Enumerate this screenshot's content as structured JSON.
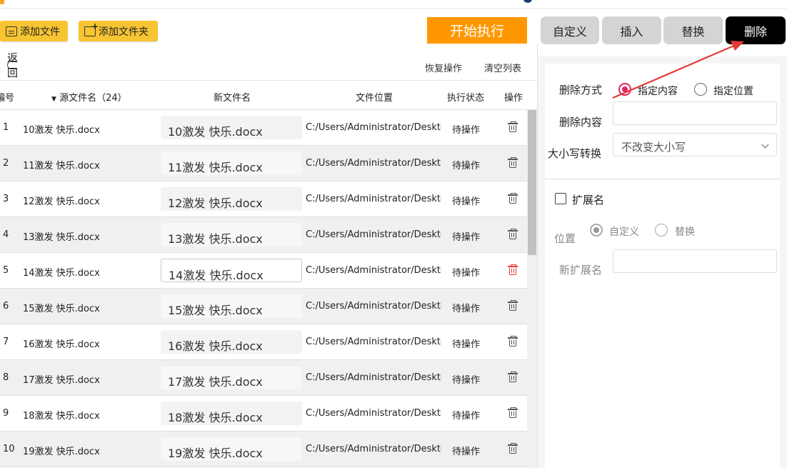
{
  "toolbar": {
    "add_file": "添加文件",
    "add_folder": "添加文件夹",
    "start": "开始执行"
  },
  "tabs": [
    {
      "label": "自定义"
    },
    {
      "label": "插入"
    },
    {
      "label": "替换"
    },
    {
      "label": "删除"
    }
  ],
  "list_actions": {
    "back": "返回",
    "restore": "恢复操作",
    "clear": "清空列表"
  },
  "columns": {
    "num": "编号",
    "source": "源文件名（24）",
    "new_name": "新文件名",
    "location": "文件位置",
    "status": "执行状态",
    "action": "操作"
  },
  "rows": [
    {
      "num": "1",
      "source": "10激发 快乐.docx",
      "new_name": "10激发 快乐.docx",
      "location": "C:/Users/Administrator/Desktop/",
      "status": "待操作"
    },
    {
      "num": "2",
      "source": "11激发 快乐.docx",
      "new_name": "11激发 快乐.docx",
      "location": "C:/Users/Administrator/Desktop/",
      "status": "待操作"
    },
    {
      "num": "3",
      "source": "12激发 快乐.docx",
      "new_name": "12激发 快乐.docx",
      "location": "C:/Users/Administrator/Desktop/",
      "status": "待操作"
    },
    {
      "num": "4",
      "source": "13激发 快乐.docx",
      "new_name": "13激发 快乐.docx",
      "location": "C:/Users/Administrator/Desktop/",
      "status": "待操作"
    },
    {
      "num": "5",
      "source": "14激发 快乐.docx",
      "new_name": "14激发 快乐.docx",
      "location": "C:/Users/Administrator/Desktop/",
      "status": "待操作"
    },
    {
      "num": "6",
      "source": "15激发 快乐.docx",
      "new_name": "15激发 快乐.docx",
      "location": "C:/Users/Administrator/Desktop/",
      "status": "待操作"
    },
    {
      "num": "7",
      "source": "16激发 快乐.docx",
      "new_name": "16激发 快乐.docx",
      "location": "C:/Users/Administrator/Desktop/",
      "status": "待操作"
    },
    {
      "num": "8",
      "source": "17激发 快乐.docx",
      "new_name": "17激发 快乐.docx",
      "location": "C:/Users/Administrator/Desktop/",
      "status": "待操作"
    },
    {
      "num": "9",
      "source": "18激发 快乐.docx",
      "new_name": "18激发 快乐.docx",
      "location": "C:/Users/Administrator/Desktop/",
      "status": "待操作"
    },
    {
      "num": "10",
      "source": "19激发 快乐.docx",
      "new_name": "19激发 快乐.docx",
      "location": "C:/Users/Administrator/Desktop/",
      "status": "待操作"
    }
  ],
  "panel": {
    "delete_mode_label": "删除方式",
    "mode_options": [
      "指定内容",
      "指定位置"
    ],
    "mode_selected": "指定内容",
    "delete_content_label": "删除内容",
    "delete_content_value": "",
    "case_label": "大小写转换",
    "case_value": "不改变大小写",
    "ext_label": "扩展名",
    "ext_checked": false,
    "position_label": "位置",
    "position_options": [
      "自定义",
      "替换"
    ],
    "position_selected": "自定义",
    "new_ext_label": "新扩展名",
    "new_ext_value": ""
  },
  "colors": {
    "accent_yellow": "#f7c432",
    "start_orange": "#ff9800",
    "radio_pink": "#e0245e",
    "arrow_red": "#e53935",
    "tab_gray": "#d4d4d4",
    "tab_active": "#000000"
  }
}
